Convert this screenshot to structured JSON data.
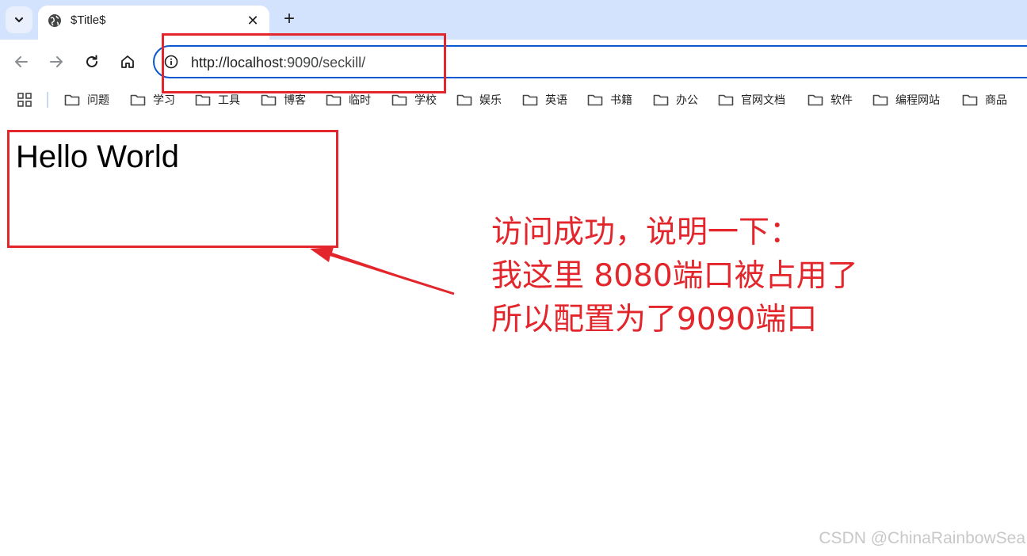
{
  "tab": {
    "title": "$Title$",
    "close_glyph": "✕",
    "favicon": "globe-icon"
  },
  "new_tab_glyph": "+",
  "toolbar": {
    "back": "back-arrow-icon",
    "forward": "forward-arrow-icon",
    "reload": "reload-icon",
    "home": "home-icon"
  },
  "address": {
    "scheme_host": "http://localhost",
    "rest": ":9090/seckill/"
  },
  "bookmarks": [
    {
      "label": "问题"
    },
    {
      "label": "学习"
    },
    {
      "label": "工具"
    },
    {
      "label": "博客"
    },
    {
      "label": "临时"
    },
    {
      "label": "学校"
    },
    {
      "label": "娱乐"
    },
    {
      "label": "英语"
    },
    {
      "label": "书籍"
    },
    {
      "label": "办公"
    },
    {
      "label": "官网文档"
    },
    {
      "label": "软件"
    },
    {
      "label": "编程网站"
    },
    {
      "label": "商品"
    }
  ],
  "page": {
    "heading": "Hello World"
  },
  "annotation": {
    "lines": [
      "访问成功，说明一下：",
      "我这里 8080端口被占用了",
      "所以配置为了9090端口"
    ],
    "color": "#e3252c"
  },
  "watermark": "CSDN @ChinaRainbowSea",
  "colors": {
    "tabstrip": "#d3e3fd",
    "omnibox_border": "#0b57d0"
  }
}
